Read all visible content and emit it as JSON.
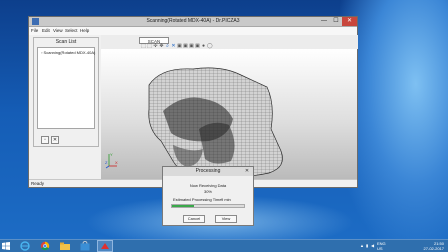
{
  "window": {
    "title": "Scanning(Rotated MDX-40A) - Dr.PICZA3",
    "minimize_glyph": "—",
    "maximize_glyph": "☐",
    "close_glyph": "✕"
  },
  "menu": [
    "File",
    "Edit",
    "View",
    "Select",
    "Help"
  ],
  "toolbar": {
    "scan_label": "SCAN",
    "icons": [
      "select-icon",
      "lasso-icon",
      "rotate-icon",
      "pan-icon",
      "zoom-icon",
      "fit-icon",
      "view-iso-icon",
      "view-front-icon",
      "view-side-icon",
      "view-top-icon",
      "shade-icon",
      "wire-icon"
    ]
  },
  "left_panel": {
    "title": "Scan List",
    "items": [
      "Scanning(Rotated MDX-40A)"
    ]
  },
  "status": {
    "text": "Ready"
  },
  "axis": {
    "y": "Y",
    "x": "X",
    "z": "Z"
  },
  "dialog": {
    "title": "Processing",
    "message": "Now Receiving Data",
    "percent": "30%",
    "progress": 0.3,
    "est_label": "Estimated Processing Time",
    "est_value": "9 min",
    "cancel_label": "Cancel",
    "view_label": "View",
    "close_glyph": "✕"
  },
  "taskbar": {
    "apps": [
      "ie-icon",
      "chrome-icon",
      "explorer-icon",
      "store-icon",
      "drpicza-icon"
    ],
    "lang_top": "ENG",
    "lang_bottom": "US",
    "time": "21:50",
    "date": "27-02-2017"
  },
  "colors": {
    "desktop": "#155db6",
    "taskbar": "#2f6fae",
    "progress": "#3aa84a",
    "close": "#c8463c"
  }
}
